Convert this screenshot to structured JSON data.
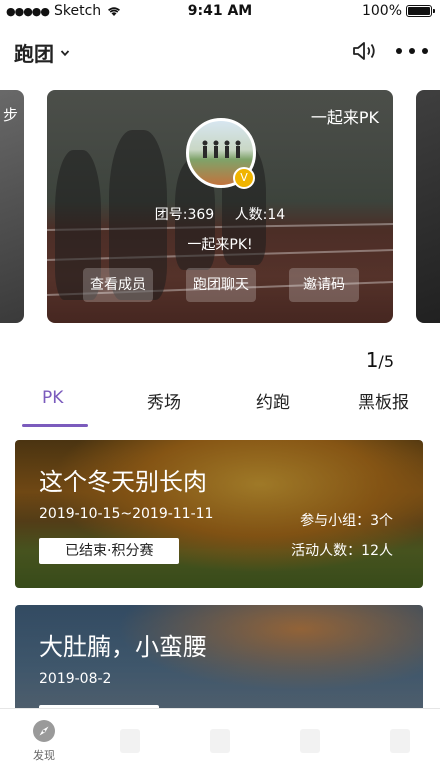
{
  "status_bar": {
    "carrier": "Sketch",
    "time": "9:41 AM",
    "battery": "100%"
  },
  "nav": {
    "title": "跑团",
    "title_icon": "chevron-down-icon",
    "icons": [
      "speaker-icon",
      "more-icon"
    ]
  },
  "carousel": {
    "left_card_text": "步",
    "card": {
      "label": "一起来PK",
      "group_no": "团号:369",
      "members": "人数:14",
      "slogan": "一起来PK!",
      "badge": "V",
      "buttons": [
        "查看成员",
        "跑团聊天",
        "邀请码"
      ]
    },
    "pager": {
      "current": "1",
      "total": "/5"
    }
  },
  "tabs": {
    "items": [
      "PK",
      "秀场",
      "约跑",
      "黑板报"
    ],
    "active": "PK",
    "accent": "#7b5bbd"
  },
  "activities": [
    {
      "title": "这个冬天别长肉",
      "date": "2019-10-15~2019-11-11",
      "groups": "参与小组：3个",
      "members": "活动人数：12人",
      "status": "已结束·积分赛"
    },
    {
      "title": "大肚腩，小蛮腰",
      "date": "2019-08-2"
    }
  ],
  "bottom_nav": {
    "items": [
      {
        "label": "发现",
        "icon": "compass-icon"
      }
    ]
  }
}
